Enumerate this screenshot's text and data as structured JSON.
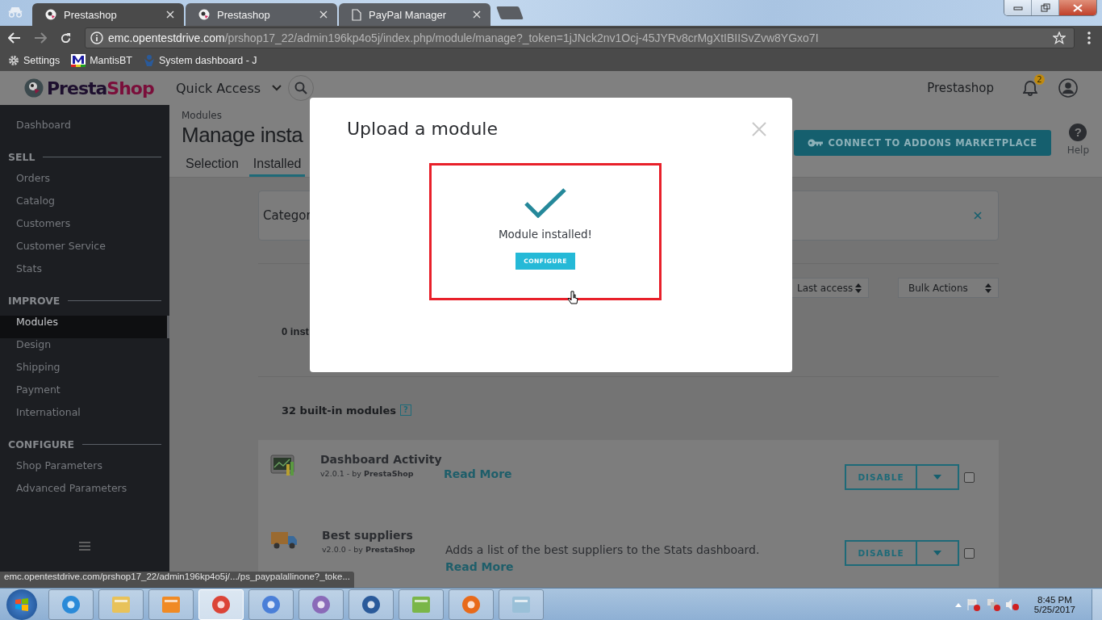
{
  "browser": {
    "tabs": [
      {
        "title": "Prestashop",
        "kind": "prestashop",
        "selected": true
      },
      {
        "title": "Prestashop",
        "kind": "prestashop",
        "selected": false
      },
      {
        "title": "PayPal Manager",
        "kind": "page",
        "selected": false
      }
    ],
    "url_host": "emc.opentestdrive.com",
    "url_path": "/prshop17_22/admin196kp4o5j/index.php/module/manage?_token=1jJNck2nv1Ocj-45JYRv8crMgXtIBIISvZvw8YGxo7I",
    "bookmarks": [
      {
        "label": "Settings",
        "kind": "gear"
      },
      {
        "label": "MantisBT",
        "kind": "mantis"
      },
      {
        "label": "System dashboard - J",
        "kind": "jira"
      }
    ]
  },
  "header": {
    "logo": [
      "Presta",
      "Shop"
    ],
    "quick_access": "Quick Access",
    "shop_name": "Prestashop",
    "notification_count": "2"
  },
  "sidebar": {
    "items": [
      {
        "label": "Dashboard",
        "kind": "link",
        "selected": false
      },
      {
        "label": "SELL",
        "kind": "section"
      },
      {
        "label": "Orders",
        "kind": "link",
        "selected": false
      },
      {
        "label": "Catalog",
        "kind": "link",
        "selected": false
      },
      {
        "label": "Customers",
        "kind": "link",
        "selected": false
      },
      {
        "label": "Customer Service",
        "kind": "link",
        "selected": false
      },
      {
        "label": "Stats",
        "kind": "link",
        "selected": false
      },
      {
        "label": "IMPROVE",
        "kind": "section"
      },
      {
        "label": "Modules",
        "kind": "link",
        "selected": true
      },
      {
        "label": "Design",
        "kind": "link",
        "selected": false
      },
      {
        "label": "Shipping",
        "kind": "link",
        "selected": false
      },
      {
        "label": "Payment",
        "kind": "link",
        "selected": false
      },
      {
        "label": "International",
        "kind": "link",
        "selected": false
      },
      {
        "label": "CONFIGURE",
        "kind": "section"
      },
      {
        "label": "Shop Parameters",
        "kind": "link",
        "selected": false
      },
      {
        "label": "Advanced Parameters",
        "kind": "link",
        "selected": false
      }
    ]
  },
  "page": {
    "breadcrumb": "Modules",
    "title": "Manage insta",
    "tabs": [
      {
        "label": "Selection",
        "selected": false
      },
      {
        "label": "Installed",
        "selected": true
      }
    ],
    "connect_button": "CONNECT TO ADDONS MARKETPLACE",
    "help_icon": "?",
    "help": "Help",
    "filter_label": "Categor",
    "sort": "Last access",
    "bulk_actions": "Bulk Actions",
    "installed_count": "0 inst",
    "builtin_count": "32 built-in modules",
    "builtin_help": "?",
    "modules": [
      {
        "name": "Dashboard Activity",
        "kind": "chart",
        "version": "v2.0.1 - by",
        "author": "PrestaShop",
        "link": "Read More",
        "action": "DISABLE",
        "checked": false
      },
      {
        "name": "Best suppliers",
        "kind": "truck",
        "version": "v2.0.0 - by",
        "author": "PrestaShop",
        "description": "Adds a list of the best suppliers to the Stats dashboard.",
        "link": "Read More",
        "action": "DISABLE",
        "checked": false
      }
    ]
  },
  "modal": {
    "title": "Upload a module",
    "message": "Module installed!",
    "button": "CONFIGURE"
  },
  "status_url": "emc.opentestdrive.com/prshop17_22/admin196kp4o5j/.../ps_paypalallinone?_toke...",
  "taskbar": {
    "apps": [
      {
        "kind": "ie",
        "selected": false
      },
      {
        "kind": "folder",
        "selected": false
      },
      {
        "kind": "media",
        "selected": false
      },
      {
        "kind": "chrome",
        "selected": true
      },
      {
        "kind": "chromium",
        "selected": false
      },
      {
        "kind": "pidgin",
        "selected": false
      },
      {
        "kind": "thunderbird",
        "selected": false
      },
      {
        "kind": "notepadpp",
        "selected": false
      },
      {
        "kind": "firefox",
        "selected": false
      },
      {
        "kind": "notepad",
        "selected": false
      }
    ],
    "time": "8:45 PM",
    "date": "5/25/2017"
  }
}
